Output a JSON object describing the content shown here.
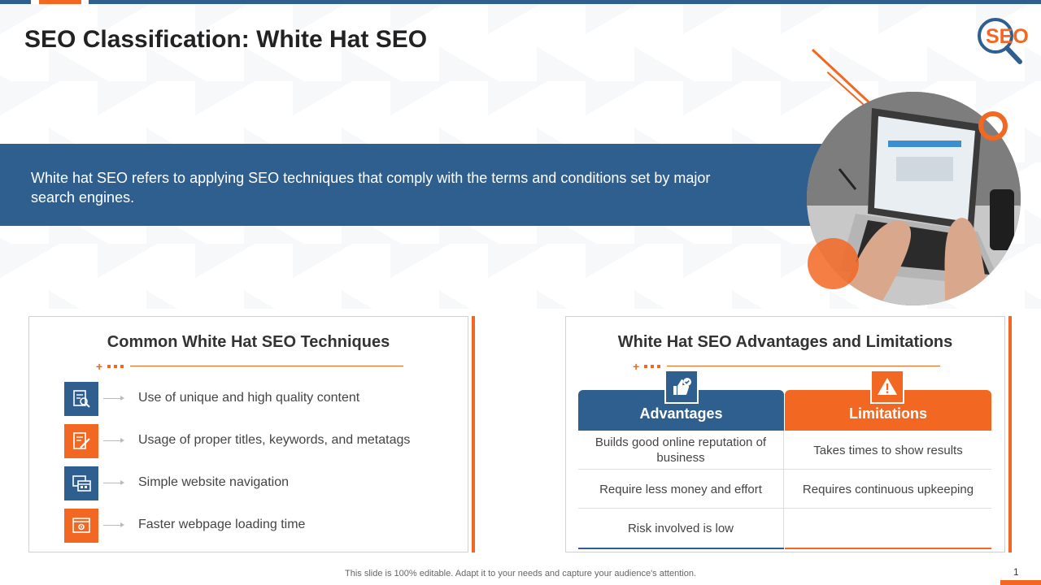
{
  "title": "SEO Classification: White Hat SEO",
  "logo_text": "SEO",
  "banner_text": "White hat SEO refers to applying SEO techniques that comply with the terms and conditions set by major search engines.",
  "techniques": {
    "heading": "Common White Hat SEO Techniques",
    "items": [
      {
        "label": "Use of unique and high quality content",
        "icon": "content-search-icon",
        "color": "blue"
      },
      {
        "label": "Usage of proper titles, keywords, and metatags",
        "icon": "edit-document-icon",
        "color": "orange"
      },
      {
        "label": "Simple website navigation",
        "icon": "website-navigation-icon",
        "color": "blue"
      },
      {
        "label": "Faster webpage loading time",
        "icon": "webpage-settings-icon",
        "color": "orange"
      }
    ]
  },
  "adv_lim": {
    "heading": "White Hat SEO Advantages and Limitations",
    "advantages_header": "Advantages",
    "limitations_header": "Limitations",
    "advantages_icon": "thumbs-up-check-icon",
    "limitations_icon": "warning-icon",
    "rows": [
      {
        "advantage": "Builds good online reputation of business",
        "limitation": "Takes times to show results"
      },
      {
        "advantage": "Require less money and effort",
        "limitation": "Requires continuous  upkeeping"
      },
      {
        "advantage": "Risk involved  is low",
        "limitation": ""
      }
    ]
  },
  "footer_note": "This slide is 100% editable. Adapt it to your needs and capture your audience's attention.",
  "slide_number": "1",
  "colors": {
    "primary_blue": "#2f5f8f",
    "accent_orange": "#f26722"
  }
}
